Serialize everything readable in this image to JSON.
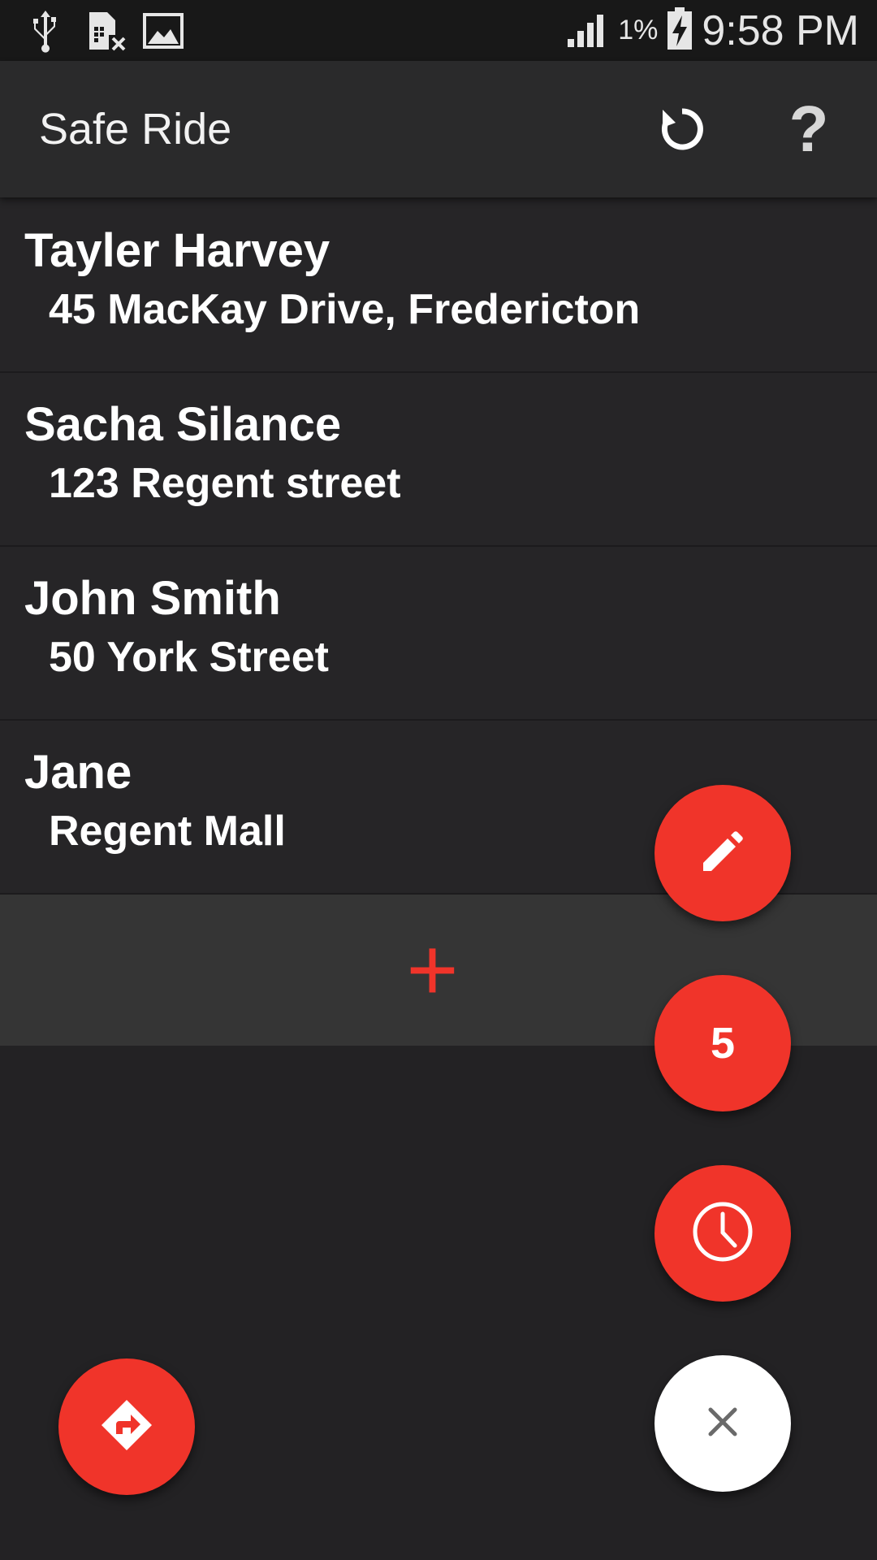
{
  "status_bar": {
    "icons_left": [
      "usb-icon",
      "sim-card-icon",
      "image-icon"
    ],
    "battery_percent": "1%",
    "time": "9:58 PM"
  },
  "app_bar": {
    "title": "Safe Ride",
    "actions": [
      "refresh-icon",
      "help-icon"
    ],
    "help_glyph": "?"
  },
  "riders": [
    {
      "name": "Tayler Harvey",
      "address": "45 MacKay Drive, Fredericton"
    },
    {
      "name": "Sacha Silance",
      "address": "123 Regent street"
    },
    {
      "name": "John Smith",
      "address": "50 York Street"
    },
    {
      "name": "Jane",
      "address": "Regent Mall"
    }
  ],
  "add_row": {
    "glyph": "+"
  },
  "fabs": {
    "edit_icon": "pencil-icon",
    "count": "5",
    "clock_icon": "clock-icon",
    "close_icon": "close-icon",
    "directions_icon": "directions-icon"
  },
  "colors": {
    "accent": "#f0342a",
    "background": "#232224",
    "app_bar": "#2a2a2b",
    "add_row": "#353535"
  }
}
